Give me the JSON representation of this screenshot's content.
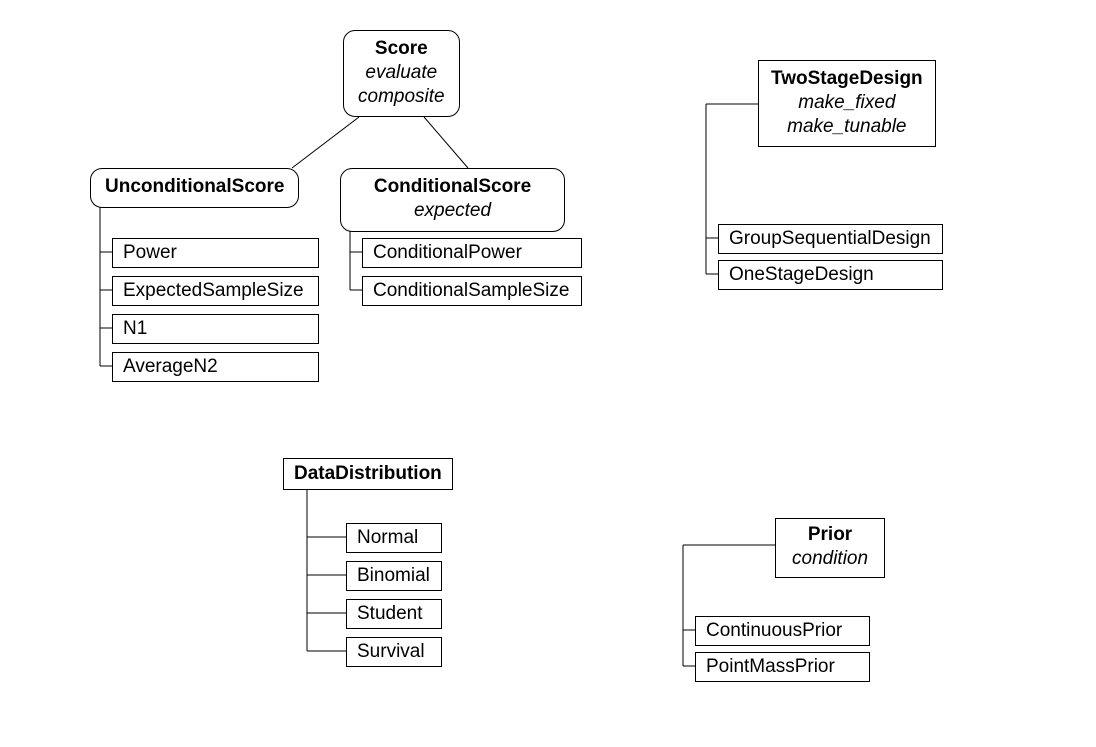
{
  "score": {
    "name": "Score",
    "methods": [
      "evaluate",
      "composite"
    ]
  },
  "unconditional": {
    "name": "UnconditionalScore",
    "children": [
      "Power",
      "ExpectedSampleSize",
      "N1",
      "AverageN2"
    ]
  },
  "conditional": {
    "name": "ConditionalScore",
    "method": "expected",
    "children": [
      "ConditionalPower",
      "ConditionalSampleSize"
    ]
  },
  "twostage": {
    "name": "TwoStageDesign",
    "methods": [
      "make_fixed",
      "make_tunable"
    ],
    "children": [
      "GroupSequentialDesign",
      "OneStageDesign"
    ]
  },
  "datadist": {
    "name": "DataDistribution",
    "children": [
      "Normal",
      "Binomial",
      "Student",
      "Survival"
    ]
  },
  "prior": {
    "name": "Prior",
    "method": "condition",
    "children": [
      "ContinuousPrior",
      "PointMassPrior"
    ]
  }
}
